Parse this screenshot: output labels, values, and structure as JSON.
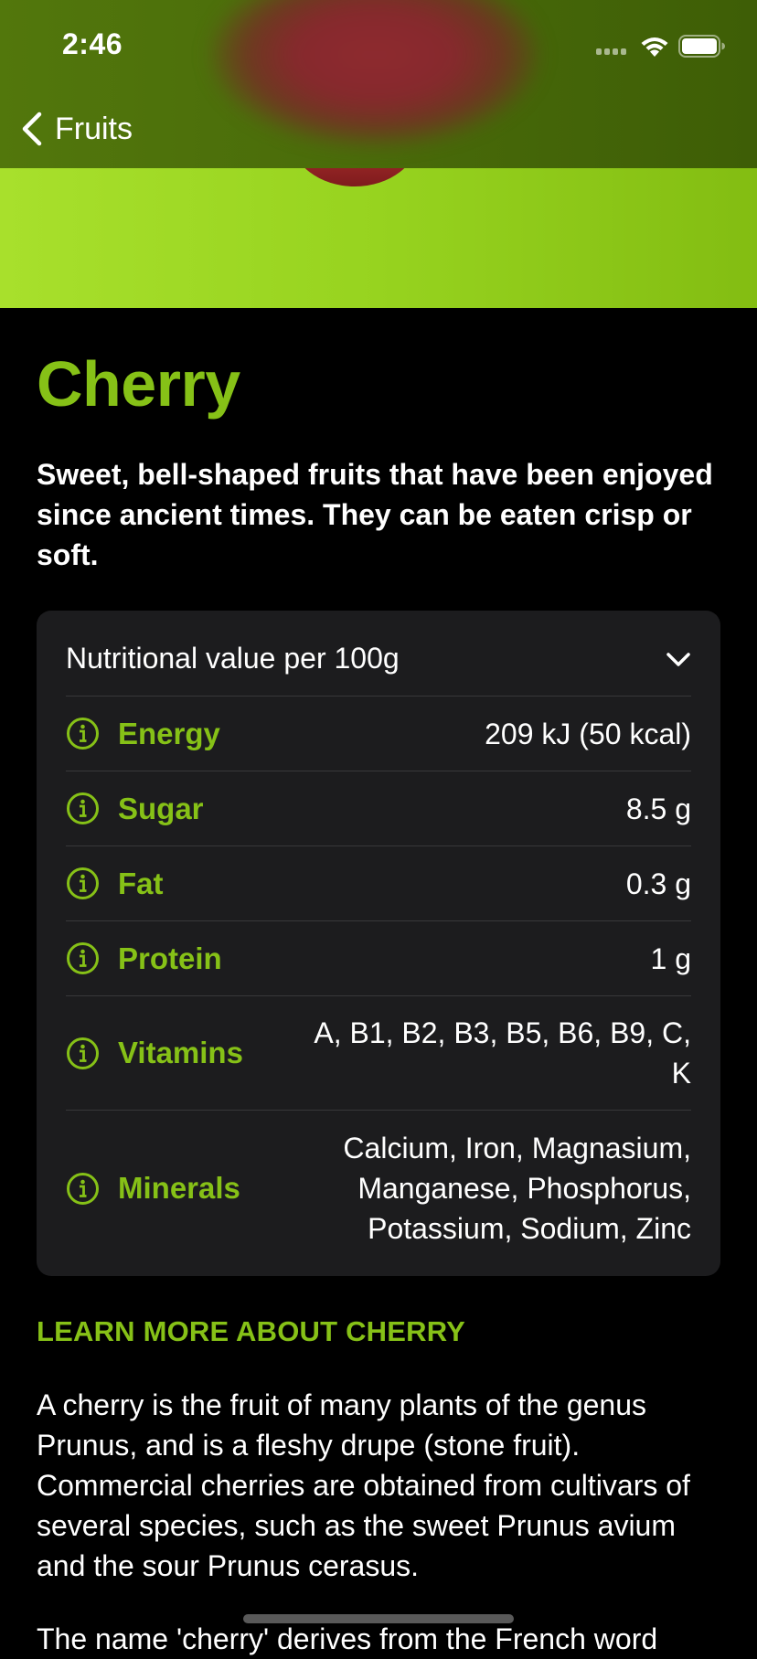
{
  "status_bar": {
    "time": "2:46"
  },
  "nav": {
    "back_label": "Fruits",
    "back_icon": "chevron-left-icon"
  },
  "fruit": {
    "title": "Cherry",
    "headline": "Sweet, bell-shaped fruits that have been enjoyed since ancient times. They can be eaten crisp or soft."
  },
  "nutrition": {
    "header_label": "Nutritional value per 100g",
    "expand_icon": "chevron-down-icon",
    "rows": [
      {
        "label": "Energy",
        "value": "209 kJ (50 kcal)"
      },
      {
        "label": "Sugar",
        "value": "8.5 g"
      },
      {
        "label": "Fat",
        "value": "0.3 g"
      },
      {
        "label": "Protein",
        "value": "1 g"
      },
      {
        "label": "Vitamins",
        "value": "A, B1, B2, B3, B5, B6, B9, C, K"
      },
      {
        "label": "Minerals",
        "value": "Calcium, Iron, Magnasium, Manganese, Phosphorus, Potassium, Sodium, Zinc"
      }
    ]
  },
  "learn_more": {
    "heading": "LEARN MORE ABOUT CHERRY",
    "description": "A cherry is the fruit of many plants of the genus Prunus, and is a fleshy drupe (stone fruit). Commercial cherries are obtained from cultivars of several species, such as the sweet Prunus avium and the sour Prunus cerasus.",
    "description_cut": "The name 'cherry' derives from the French word"
  },
  "colors": {
    "accent": "#86c117",
    "background": "#000000",
    "card": "#1c1c1e",
    "hero_green": "#97d31f"
  }
}
